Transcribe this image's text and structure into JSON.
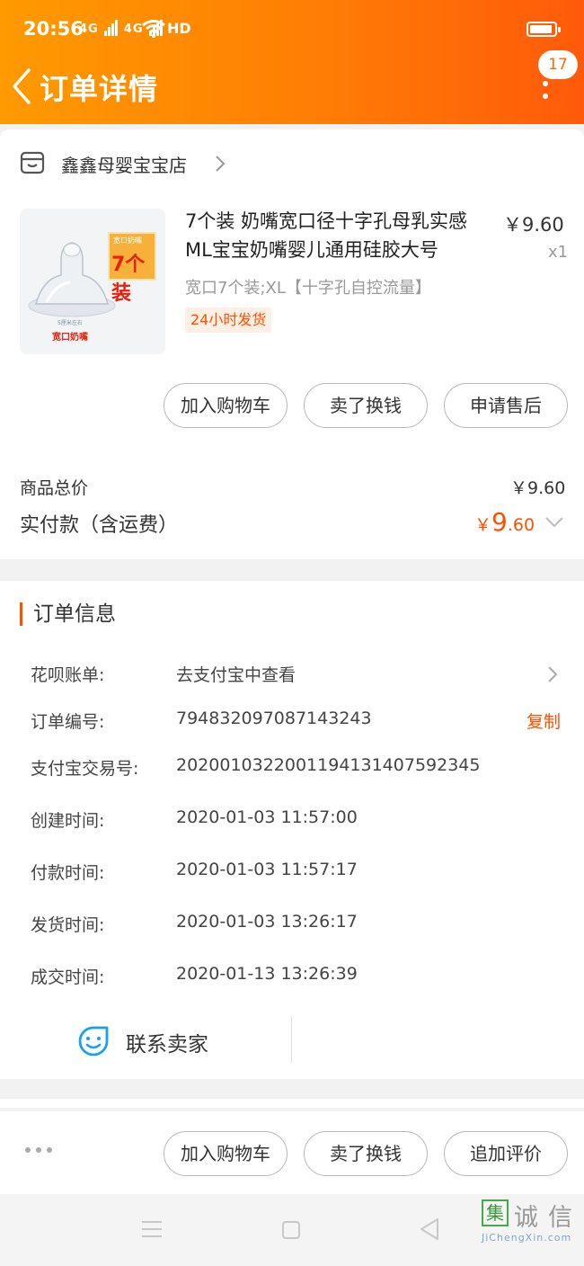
{
  "status_bar": {
    "time": "20:56",
    "network_1": "4G",
    "network_2": "4G",
    "hd": "HD"
  },
  "header": {
    "title": "订单详情",
    "badge_count": "17",
    "bg_color": "#ff7d05"
  },
  "shop": {
    "name": "鑫鑫母婴宝宝店"
  },
  "product": {
    "title": "7个装 奶嘴宽口径十字孔母乳实感ML宝宝奶嘴婴儿通用硅胶大号",
    "price": "￥9.60",
    "quantity": "x1",
    "spec": "宽口7个装;XL【十字孔自控流量】",
    "shipping_tag": "24小时发货",
    "thumbnail": {
      "tag_top": "宽口奶嘴",
      "tag_main": "7个装",
      "label": "宽口奶嘴",
      "note": "5厘米左右"
    }
  },
  "actions": {
    "add_cart": "加入购物车",
    "resell": "卖了换钱",
    "after_sale": "申请售后"
  },
  "summary": {
    "total_label": "商品总价",
    "total_value": "￥9.60",
    "paid_label": "实付款（含运费）",
    "paid_currency": "￥",
    "paid_int": "9",
    "paid_dec": ".60",
    "accent_color": "#ff5000"
  },
  "order_info": {
    "title": "订单信息",
    "rows": [
      {
        "label": "花呗账单:",
        "value": "去支付宝中查看"
      },
      {
        "label": "订单编号:",
        "value": "794832097087143243",
        "action": "复制"
      },
      {
        "label": "支付宝交易号:",
        "value": "2020010322001194131407592345"
      },
      {
        "label": "创建时间:",
        "value": "2020-01-03 11:57:00"
      },
      {
        "label": "付款时间:",
        "value": "2020-01-03 11:57:17"
      },
      {
        "label": "发货时间:",
        "value": "2020-01-03 13:26:17"
      },
      {
        "label": "成交时间:",
        "value": "2020-01-13 13:26:39"
      }
    ],
    "contact_seller": "联系卖家"
  },
  "bottom_bar": {
    "add_cart": "加入购物车",
    "resell": "卖了换钱",
    "add_review": "追加评价"
  },
  "watermark": {
    "char1": "集",
    "char2": "诚",
    "char3": "信",
    "url": "JiChengXin.com"
  },
  "icons": [
    "back-arrow-icon",
    "more-vertical-icon",
    "store-icon",
    "chevron-right-icon",
    "chevron-down-icon",
    "smile-chat-icon",
    "more-dots-icon",
    "menu-icon",
    "home-icon",
    "back-triangle-icon",
    "wifi-icon",
    "battery-icon"
  ]
}
